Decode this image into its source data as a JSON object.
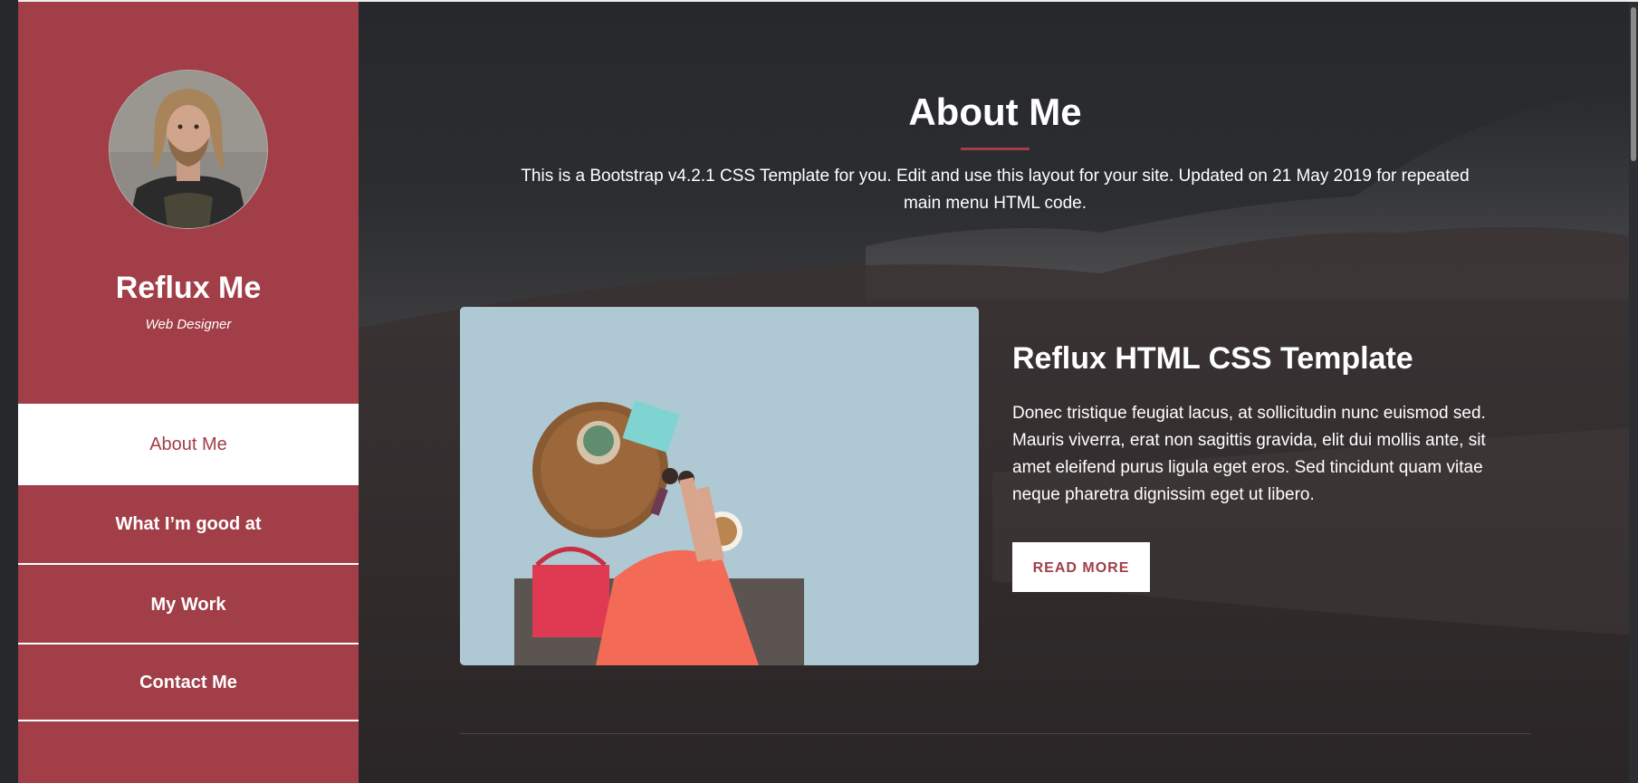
{
  "sidebar": {
    "site_name": "Reflux Me",
    "site_role": "Web Designer",
    "avatar_icon": "profile-photo",
    "nav": [
      {
        "label": "About Me",
        "active": true
      },
      {
        "label": "What I’m good at",
        "active": false
      },
      {
        "label": "My Work",
        "active": false
      },
      {
        "label": "Contact Me",
        "active": false
      }
    ]
  },
  "main": {
    "title": "About Me",
    "intro": "This is a Bootstrap v4.2.1 CSS Template for you. Edit and use this layout for your site. Updated on 21 May 2019 for repeated main menu HTML code.",
    "feature": {
      "title": "Reflux HTML CSS Template",
      "text": "Donec tristique feugiat lacus, at sollicitudin nunc euismod sed. Mauris viverra, erat non sagittis gravida, elit dui mollis ante, sit amet eleifend purus ligula eget eros. Sed tincidunt quam vitae neque pharetra dignissim eget ut libero.",
      "button_label": "READ MORE"
    }
  },
  "colors": {
    "accent": "#a13e48",
    "background": "#232427",
    "text": "#ffffff"
  }
}
